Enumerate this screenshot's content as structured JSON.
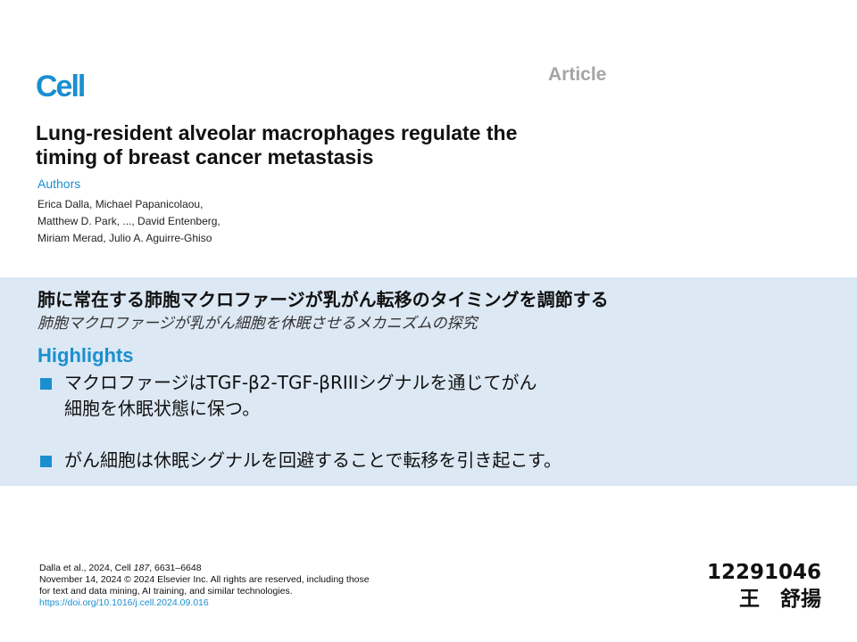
{
  "header": {
    "logo_text": "Cell",
    "article_label": "Article"
  },
  "paper": {
    "title_line1": "Lung-resident alveolar macrophages regulate the",
    "title_line2": "timing of breast cancer metastasis",
    "authors_heading": "Authors",
    "authors_lines": [
      "Erica Dalla, Michael Papanicolaou,",
      "Matthew D. Park, ..., David Entenberg,",
      "Miriam Merad, Julio A. Aguirre-Ghiso"
    ]
  },
  "summary": {
    "jp_title": "肺に常在する肺胞マクロファージが乳がん転移のタイミングを調節する",
    "jp_subtitle": "肺胞マクロファージが乳がん細胞を休眠させるメカニズムの探究",
    "highlights_heading": "Highlights",
    "highlights": [
      {
        "line1": "マクロファージはTGF-β2-TGF-βRIIIシグナルを通じてがん",
        "line2": "細胞を休眠状態に保つ。"
      },
      {
        "line1": "がん細胞は休眠シグナルを回避することで転移を引き起こす。"
      }
    ]
  },
  "citation": {
    "line1_prefix": "Dalla et al., 2024, Cell ",
    "volume": "187",
    "pages": ", 6631–6648",
    "line2": "November 14, 2024 © 2024 Elsevier Inc. All rights are reserved, including those",
    "line3": "for text and data mining, AI training, and similar technologies.",
    "doi": "https://doi.org/10.1016/j.cell.2024.09.016"
  },
  "student": {
    "id": "12291046",
    "name": "王　舒揚"
  },
  "colors": {
    "brand_blue": "#1a8fd0",
    "band_background": "#dce8f4",
    "article_label_gray": "#a5a5a5"
  }
}
